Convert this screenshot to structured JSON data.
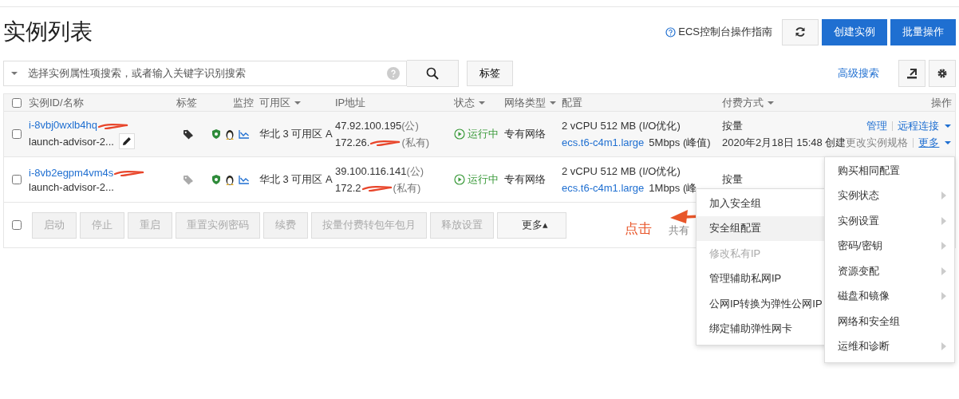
{
  "page_title": "实例列表",
  "toolbar": {
    "guide_link": "ECS控制台操作指南",
    "buttons": [
      {
        "kind": "refresh"
      },
      {
        "kind": "primary",
        "label": "创建实例"
      },
      {
        "kind": "primary",
        "label": "批量操作"
      }
    ]
  },
  "search": {
    "placeholder": "选择实例属性项搜索，或者输入关键字识别搜索",
    "tag_button": "标签",
    "advanced_link": "高级搜索"
  },
  "table": {
    "columns": [
      {
        "label": "实例ID/名称",
        "sortable": false
      },
      {
        "label": "标签",
        "sortable": false
      },
      {
        "label": "监控",
        "sortable": false
      },
      {
        "label": "可用区",
        "sortable": true
      },
      {
        "label": "IP地址",
        "sortable": false
      },
      {
        "label": "状态",
        "sortable": true
      },
      {
        "label": "网络类型",
        "sortable": true
      },
      {
        "label": "配置",
        "sortable": false
      },
      {
        "label": "付费方式",
        "sortable": true
      },
      {
        "label": "操作",
        "sortable": false
      }
    ],
    "header_checked": false,
    "rows": [
      {
        "checked": false,
        "highlighted": true,
        "id": "i-8vbj0wxlb4hq",
        "id_redacted": true,
        "name": "launch-advisor-2...",
        "editable": true,
        "tagged": true,
        "zone": "华北 3 可用区 A",
        "public_ip": "47.92.100.195",
        "public_suffix": "(公)",
        "private_ip": "172.26.",
        "private_suffix": "(私有)",
        "ip_redacted": true,
        "status": "运行中",
        "network": "专有网络",
        "spec": "2 vCPU 512 MB (I/O优化)",
        "instance_type": "ecs.t6-c4m1.large",
        "bandwidth": "5Mbps (峰值)",
        "billing": "按量",
        "created": "2020年2月18日 15:48 创建",
        "actions": [
          "管理",
          "远程连接"
        ],
        "secondary_actions": [
          "更改实例规格",
          "更多"
        ]
      },
      {
        "checked": false,
        "highlighted": false,
        "id": "i-8vb2egpm4vm4s",
        "id_redacted": true,
        "name": "launch-advisor-2...",
        "editable": false,
        "tagged": false,
        "zone": "华北 3 可用区 A",
        "public_ip": "39.100.116.141",
        "public_suffix": "(公)",
        "private_ip": "172.2",
        "private_suffix": "(私有)",
        "ip_redacted": true,
        "status": "运行中",
        "network": "专有网络",
        "spec": "2 vCPU 512 MB (I/O优化)",
        "instance_type": "ecs.t6-c4m1.large",
        "bandwidth": "1Mbps (峰",
        "billing": "按量"
      }
    ]
  },
  "footer": {
    "checked": false,
    "buttons": [
      {
        "label": "启动",
        "disabled": true
      },
      {
        "label": "停止",
        "disabled": true
      },
      {
        "label": "重启",
        "disabled": true
      },
      {
        "label": "重置实例密码",
        "disabled": true
      },
      {
        "label": "续费",
        "disabled": true
      },
      {
        "label": "按量付费转包年包月",
        "disabled": true
      },
      {
        "label": "释放设置",
        "disabled": true
      },
      {
        "label": "更多▴",
        "disabled": false
      }
    ],
    "total": "共有"
  },
  "annotation": {
    "text": "点击"
  },
  "more_menu": {
    "items": [
      {
        "label": "购买相同配置",
        "has_submenu": false
      },
      {
        "label": "实例状态",
        "has_submenu": true
      },
      {
        "label": "实例设置",
        "has_submenu": true
      },
      {
        "label": "密码/密钥",
        "has_submenu": true
      },
      {
        "label": "资源变配",
        "has_submenu": true
      },
      {
        "label": "磁盘和镜像",
        "has_submenu": true
      },
      {
        "label": "网络和安全组",
        "has_submenu": false
      },
      {
        "label": "运维和诊断",
        "has_submenu": true
      }
    ]
  },
  "submenu": {
    "items": [
      {
        "label": "加入安全组",
        "selected": false,
        "disabled": false
      },
      {
        "label": "安全组配置",
        "selected": true,
        "disabled": false
      },
      {
        "label": "修改私有IP",
        "selected": false,
        "disabled": true
      },
      {
        "label": "管理辅助私网IP",
        "selected": false,
        "disabled": false
      },
      {
        "label": "公网IP转换为弹性公网IP",
        "selected": false,
        "disabled": false
      },
      {
        "label": "绑定辅助弹性网卡",
        "selected": false,
        "disabled": false
      }
    ]
  }
}
